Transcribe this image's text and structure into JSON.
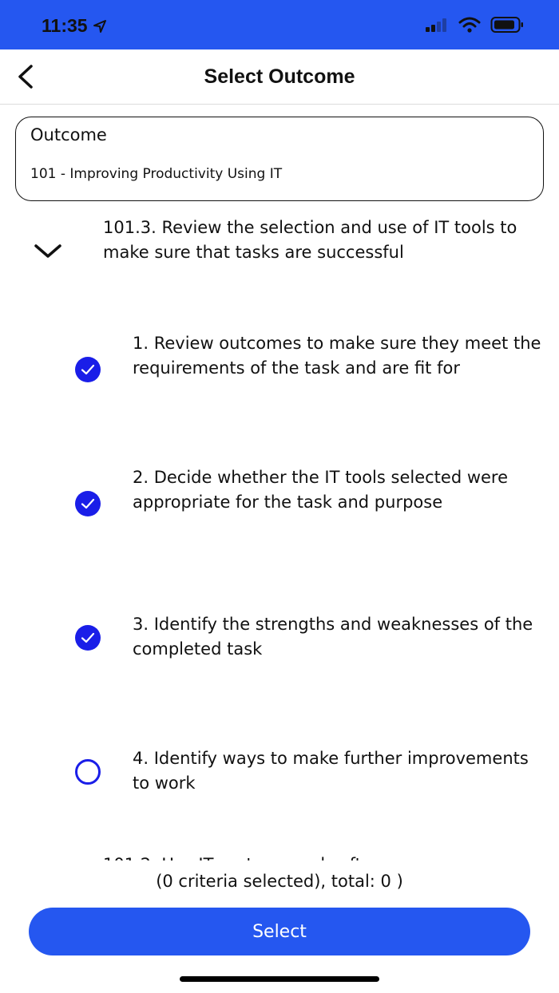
{
  "status_bar": {
    "time": "11:35",
    "icons": [
      "location-arrow-icon",
      "signal-icon",
      "wifi-icon",
      "battery-icon"
    ]
  },
  "nav": {
    "title": "Select Outcome",
    "back_icon": "chevron-left-icon"
  },
  "outcome": {
    "label": "Outcome",
    "value": "101 - Improving Productivity Using IT"
  },
  "section": {
    "title": "101.3. Review the selection and use of IT tools to make sure that tasks are successful",
    "expanded": true
  },
  "criteria": [
    {
      "text": "1. Review outcomes to make sure they meet the requirements of the task and are fit for",
      "checked": true
    },
    {
      "text": "2. Decide whether the IT tools selected were appropriate for the task and purpose",
      "checked": true
    },
    {
      "text": "3. Identify the strengths and weaknesses of the completed task",
      "checked": true
    },
    {
      "text": "4. Identify ways to make further improvements to work",
      "checked": false
    }
  ],
  "summary": "(0 criteria selected), total: 0 )",
  "select_button": "Select",
  "colors": {
    "accent": "#2557f0",
    "check_fill": "#1a1ee8"
  }
}
